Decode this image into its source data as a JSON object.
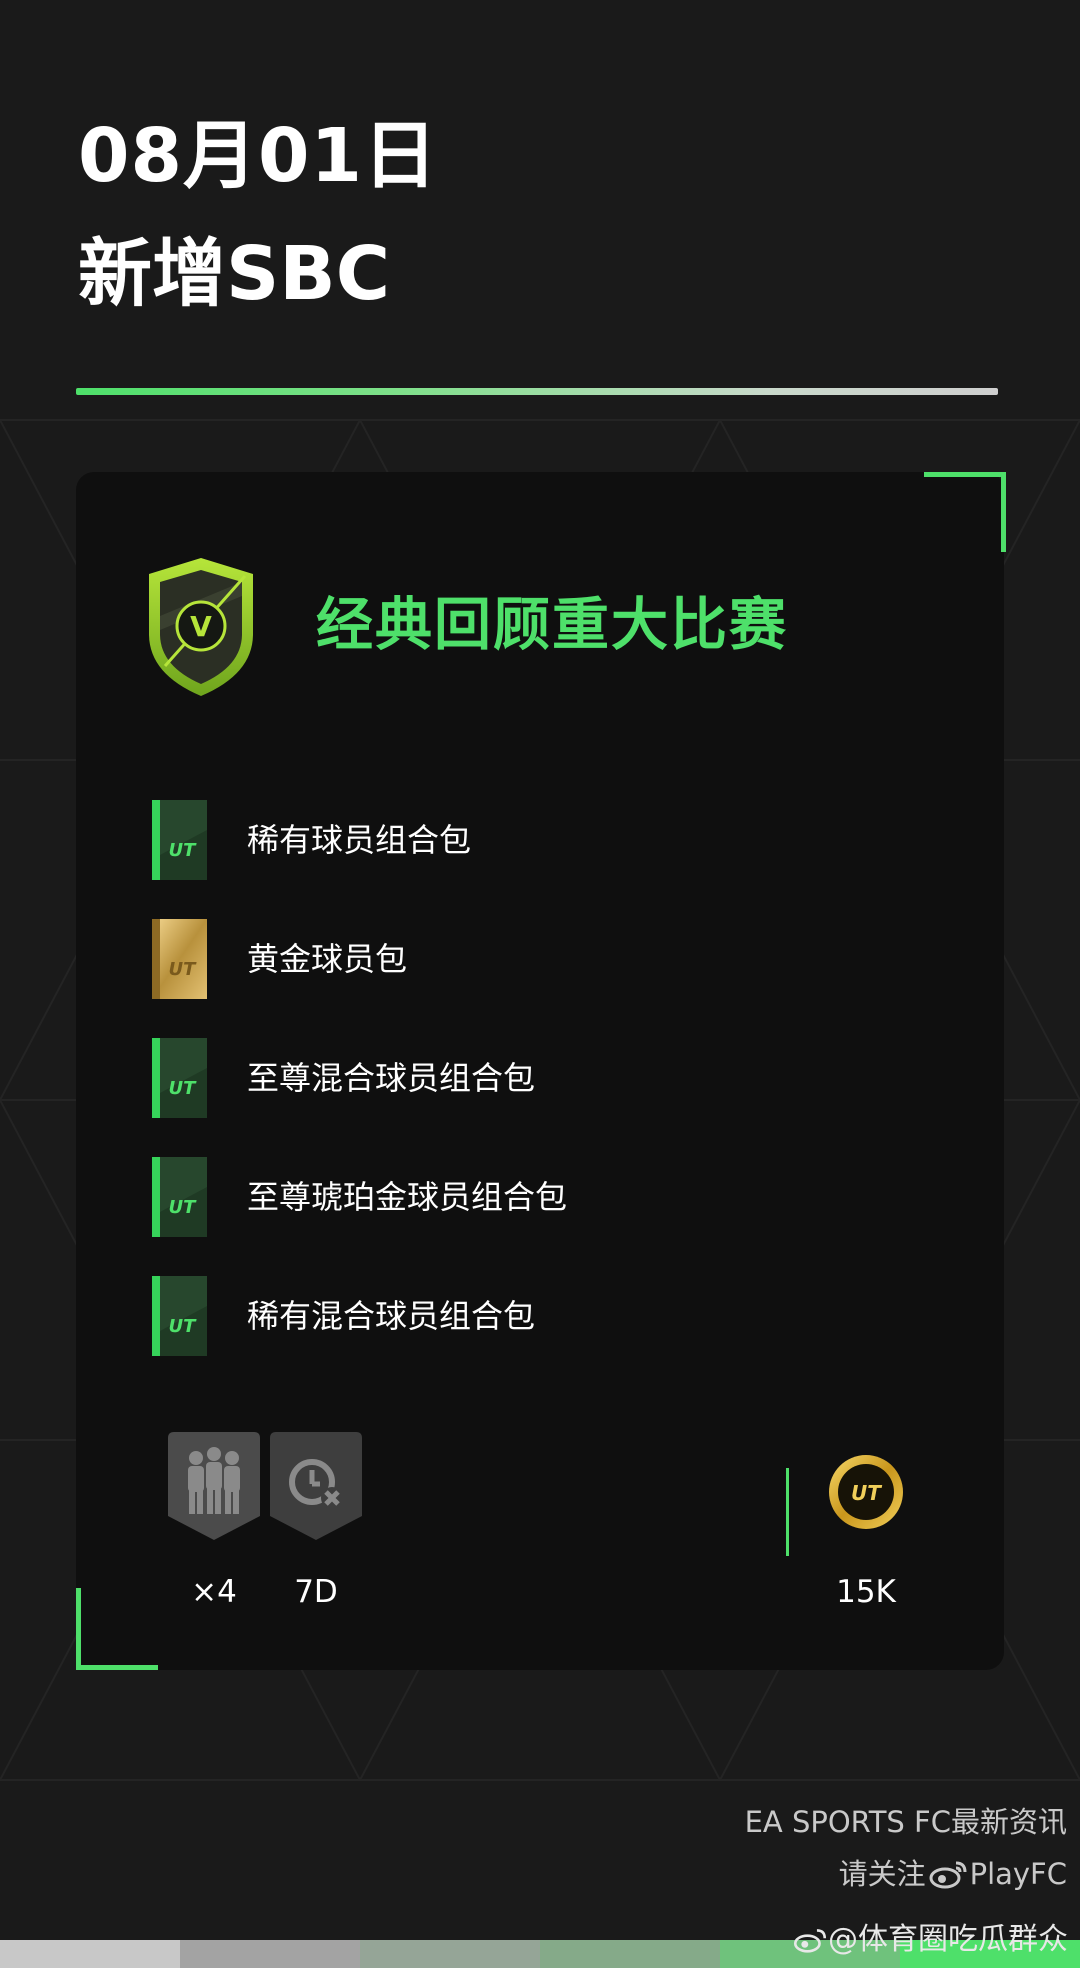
{
  "header": {
    "date": "08月01日",
    "subtitle": "新增SBC"
  },
  "sbc": {
    "title": "经典回顾重大比赛",
    "badge_letter": "V",
    "rewards": [
      {
        "label": "稀有球员组合包",
        "pack": "green-pack-icon"
      },
      {
        "label": "黄金球员包",
        "pack": "gold-pack-icon"
      },
      {
        "label": "至尊混合球员组合包",
        "pack": "green-pack-icon"
      },
      {
        "label": "至尊琥珀金球员组合包",
        "pack": "green-pack-icon"
      },
      {
        "label": "稀有混合球员组合包",
        "pack": "green-pack-icon"
      }
    ],
    "pack_mark": "UT",
    "requirements": {
      "squads_label": "×4",
      "duration_label": "7D"
    },
    "cost": {
      "coin_mark": "UT",
      "value": "15K"
    }
  },
  "footer": {
    "line1": "EA SPORTS FC最新资讯",
    "line2_prefix": "请关注",
    "line2_handle": "PlayFC"
  },
  "watermark": {
    "text": "@体育圈吃瓜群众"
  },
  "colors": {
    "background": "#1a1a1a",
    "card": "#0f0f0f",
    "accent": "#4ee06a"
  }
}
